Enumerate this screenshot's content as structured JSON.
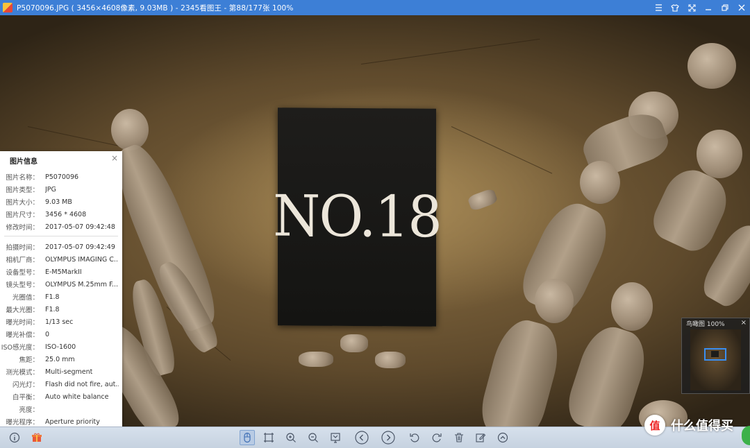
{
  "window": {
    "title": "P5070096.JPG ( 3456×4608像素, 9.03MB ) - 2345看图王 - 第88/177张 100%",
    "buttons": [
      "menu",
      "skin",
      "fullscreen",
      "minimize",
      "restore",
      "close"
    ]
  },
  "photo": {
    "sign_text": "NO.18"
  },
  "info_panel": {
    "title": "图片信息",
    "close_glyph": "×",
    "file_rows": [
      {
        "k": "图片名称：",
        "v": "P5070096"
      },
      {
        "k": "图片类型：",
        "v": "JPG"
      },
      {
        "k": "图片大小：",
        "v": "9.03 MB"
      },
      {
        "k": "图片尺寸：",
        "v": "3456 * 4608"
      },
      {
        "k": "修改时间：",
        "v": "2017-05-07 09:42:48"
      }
    ],
    "exif_rows": [
      {
        "k": "拍摄时间：",
        "v": "2017-05-07 09:42:49"
      },
      {
        "k": "相机厂商：",
        "v": "OLYMPUS IMAGING C..."
      },
      {
        "k": "设备型号：",
        "v": "E-M5MarkII"
      },
      {
        "k": "镜头型号：",
        "v": "OLYMPUS M.25mm F..."
      },
      {
        "k": "光圈值：",
        "v": "F1.8"
      },
      {
        "k": "最大光圈：",
        "v": "F1.8"
      },
      {
        "k": "曝光时间：",
        "v": "1/13 sec"
      },
      {
        "k": "曝光补偿：",
        "v": "0"
      },
      {
        "k": "ISO感光度：",
        "v": "ISO-1600"
      },
      {
        "k": "焦距：",
        "v": "25.0 mm"
      },
      {
        "k": "测光模式：",
        "v": "Multi-segment"
      },
      {
        "k": "闪光灯：",
        "v": "Flash did not fire, aut..."
      },
      {
        "k": "白平衡：",
        "v": "Auto white balance"
      },
      {
        "k": "亮度：",
        "v": ""
      },
      {
        "k": "曝光程序：",
        "v": "Aperture priority"
      }
    ]
  },
  "navigator": {
    "title": "鸟瞰图 100%",
    "close_glyph": "×"
  },
  "toolbar": {
    "left_icons": [
      "info-icon",
      "gift-icon"
    ],
    "center_icons": [
      "pan-mode-icon",
      "fit-window-icon",
      "zoom-in-icon",
      "zoom-out-icon",
      "actual-size-icon",
      "prev-icon",
      "next-icon",
      "rotate-left-icon",
      "rotate-right-icon",
      "delete-icon",
      "edit-icon",
      "more-icon"
    ]
  },
  "watermark": {
    "logo": "值",
    "text": "什么值得买"
  }
}
